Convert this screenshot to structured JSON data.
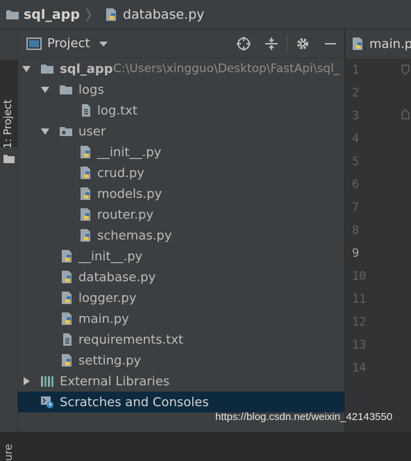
{
  "breadcrumb": {
    "root": "sql_app",
    "file": "database.py"
  },
  "stripe": {
    "project_tab": "1: Project",
    "bottom_tab": "ure"
  },
  "project_panel": {
    "title": "Project"
  },
  "tree": {
    "root": {
      "name": "sql_app",
      "path": "C:\\Users\\xingguo\\Desktop\\FastApi\\sql_"
    },
    "logs": {
      "name": "logs",
      "files": [
        "log.txt"
      ]
    },
    "user": {
      "name": "user",
      "files": [
        "__init__.py",
        "crud.py",
        "models.py",
        "router.py",
        "schemas.py"
      ]
    },
    "files": [
      "__init__.py",
      "database.py",
      "logger.py",
      "main.py",
      "requirements.txt",
      "setting.py"
    ],
    "external": "External Libraries",
    "scratches": "Scratches and Consoles"
  },
  "editor": {
    "tab": "main.p",
    "line_numbers": [
      "1",
      "2",
      "3",
      "4",
      "5",
      "6",
      "7",
      "8",
      "9",
      "10",
      "11",
      "12",
      "13",
      "14"
    ],
    "current_line": "9"
  },
  "watermark": "https://blog.csdn.net/weixin_42143550"
}
